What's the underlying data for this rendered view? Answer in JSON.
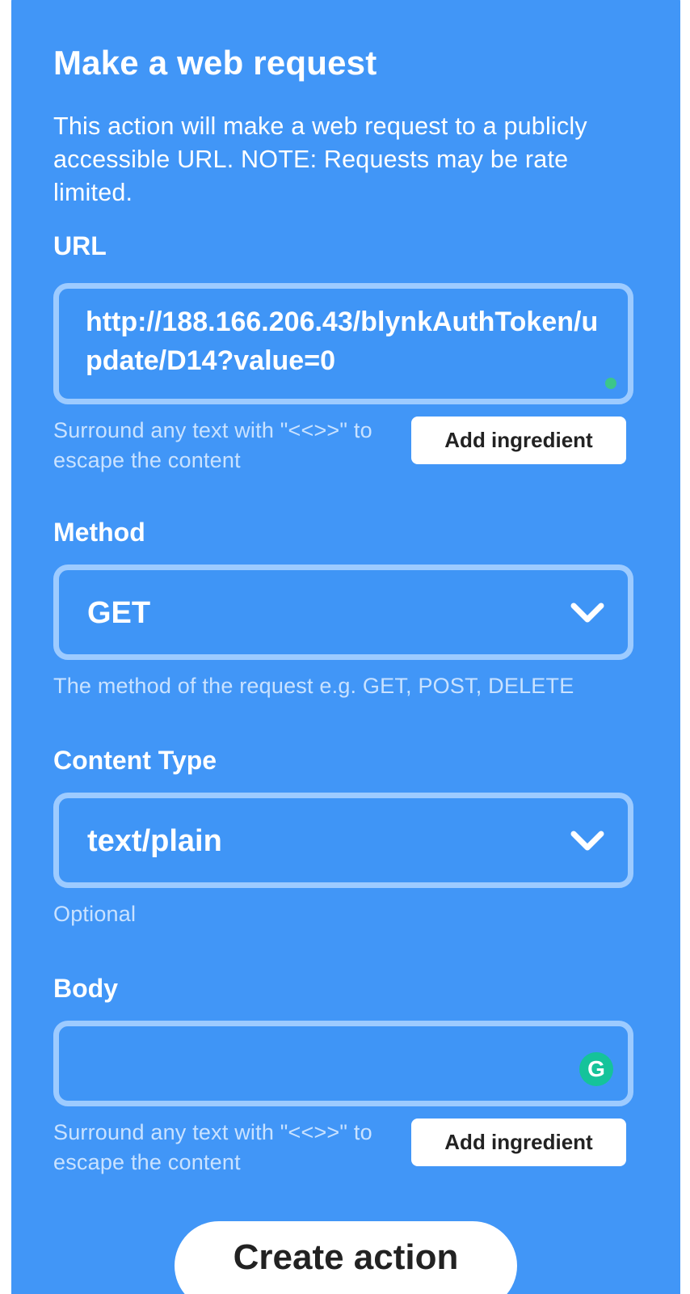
{
  "form": {
    "title": "Make a web request",
    "description": "This action will make a web request to a publicly accessible URL. NOTE: Requests may be rate limited."
  },
  "url": {
    "label": "URL",
    "value": "http://188.166.206.43/blynkAuthToken/update/D14?value=0",
    "help": "Surround any text with \"<<>>\" to escape the content",
    "add_ingredient_label": "Add ingredient"
  },
  "method": {
    "label": "Method",
    "value": "GET",
    "help": "The method of the request e.g. GET, POST, DELETE"
  },
  "content_type": {
    "label": "Content Type",
    "value": "text/plain",
    "help": "Optional"
  },
  "body": {
    "label": "Body",
    "value": "",
    "help": "Surround any text with \"<<>>\" to escape the content",
    "add_ingredient_label": "Add ingredient",
    "grammarly_glyph": "G"
  },
  "create_action_label": "Create action",
  "icons": {
    "chevron": "chevron-down-icon",
    "grammarly": "grammarly-icon"
  },
  "colors": {
    "card_background": "#4196f7",
    "field_border": "#9dcbff",
    "help_text": "#c9e2ff",
    "grammarly_green": "#15c39a"
  }
}
